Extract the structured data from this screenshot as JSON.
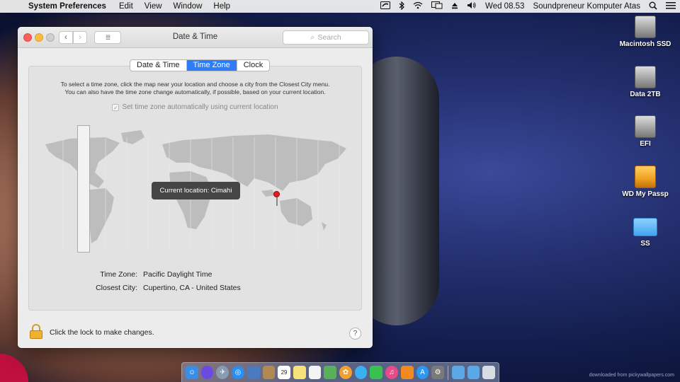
{
  "menubar": {
    "app_name": "System Preferences",
    "menus": [
      "Edit",
      "View",
      "Window",
      "Help"
    ],
    "clock": "Wed 08.53",
    "user": "Soundpreneur Komputer Atas"
  },
  "desktop": {
    "icons": [
      {
        "label": "Macintosh SSD",
        "kind": "drive"
      },
      {
        "label": "Data 2TB",
        "kind": "drive"
      },
      {
        "label": "EFI",
        "kind": "drive"
      },
      {
        "label": "WD My Passp",
        "kind": "external-drive"
      },
      {
        "label": "SS",
        "kind": "folder"
      }
    ],
    "credit": "downloaded from pickywallpapers.com"
  },
  "window": {
    "title": "Date & Time",
    "search_placeholder": "Search",
    "tabs": [
      {
        "label": "Date & Time",
        "active": false
      },
      {
        "label": "Time Zone",
        "active": true
      },
      {
        "label": "Clock",
        "active": false
      }
    ],
    "instructions_line1": "To select a time zone, click the map near your location and choose a city from the Closest City menu.",
    "instructions_line2": "You can also have the time zone change automatically, if possible, based on your current location.",
    "auto_checkbox_label": "Set time zone automatically using current location",
    "auto_checked": true,
    "tooltip": "Current location: Cimahi",
    "time_zone_label": "Time Zone:",
    "time_zone_value": "Pacific Daylight Time",
    "closest_city_label": "Closest City:",
    "closest_city_value": "Cupertino, CA - United States",
    "lock_text": "Click the lock to make changes.",
    "help_label": "?"
  },
  "dock": {
    "apps": [
      "finder",
      "siri",
      "launchpad",
      "safari",
      "photos-viewer",
      "contacts",
      "calendar",
      "notes",
      "reminders",
      "maps",
      "photos",
      "messages",
      "facetime",
      "itunes",
      "ibooks",
      "app-store",
      "system-preferences"
    ],
    "calendar_day": "29",
    "stack_items": [
      "applications-folder",
      "downloads-folder",
      "trash"
    ],
    "colors": {
      "finder": "#3a8ee6",
      "siri": "#6a4ae0",
      "launchpad": "#8a9ab0",
      "safari": "#2a8ef0",
      "photos-viewer": "#4a7ac0",
      "contacts": "#b08a50",
      "calendar": "#ffffff",
      "notes": "#f7e27a",
      "reminders": "#f4f4f4",
      "maps": "#5ab05a",
      "photos": "#f0a030",
      "messages": "#3ab0f0",
      "facetime": "#3ac050",
      "itunes": "#e84a8a",
      "ibooks": "#f08a20",
      "app-store": "#2a9af0",
      "system-preferences": "#7a7a7a"
    }
  }
}
